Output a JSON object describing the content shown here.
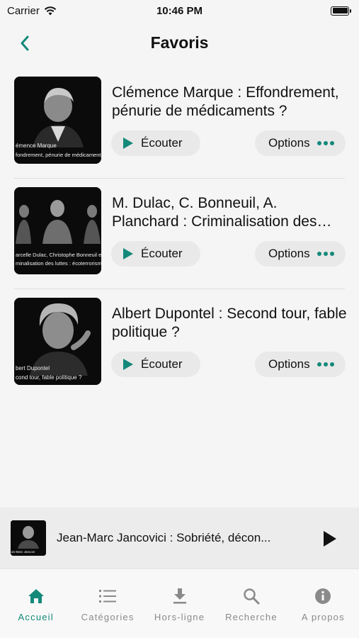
{
  "status_bar": {
    "carrier": "Carrier",
    "time": "10:46 PM"
  },
  "header": {
    "title": "Favoris"
  },
  "favorites": [
    {
      "title": "Clémence Marque : Effondrement, pénurie de médicaments ?",
      "thumb_caption_1": "émence Marque",
      "thumb_caption_2": "fondrement, pénurie de médicaments ?",
      "listen_label": "Écouter",
      "options_label": "Options"
    },
    {
      "title": "M. Dulac, C. Bonneuil, A. Planchard : Criminalisation des luttes : écoterrorisme ?",
      "thumb_caption_1": "arcelle Dulac, Christophe Bonneuil et Aliz",
      "thumb_caption_2": "minalisation des luttes : écoterrorisme ?",
      "listen_label": "Écouter",
      "options_label": "Options"
    },
    {
      "title": "Albert Dupontel : Second tour, fable politique ?",
      "thumb_caption_1": "bert Dupontel",
      "thumb_caption_2": "cond tour, fable politique ?",
      "listen_label": "Écouter",
      "options_label": "Options"
    }
  ],
  "mini_player": {
    "title": "Jean-Marc Jancovici : Sobriété, décon...",
    "thumb_caption": "an-Marc Jancovi"
  },
  "tabs": [
    {
      "label": "Accueil",
      "icon": "home-icon",
      "active": true
    },
    {
      "label": "Catégories",
      "icon": "list-icon",
      "active": false
    },
    {
      "label": "Hors-ligne",
      "icon": "download-icon",
      "active": false
    },
    {
      "label": "Recherche",
      "icon": "search-icon",
      "active": false
    },
    {
      "label": "A propos",
      "icon": "info-icon",
      "active": false
    }
  ],
  "colors": {
    "accent": "#14897a",
    "inactive": "#8a8a8a",
    "background": "#f5f5f5",
    "button_bg": "#e9e9e9"
  }
}
